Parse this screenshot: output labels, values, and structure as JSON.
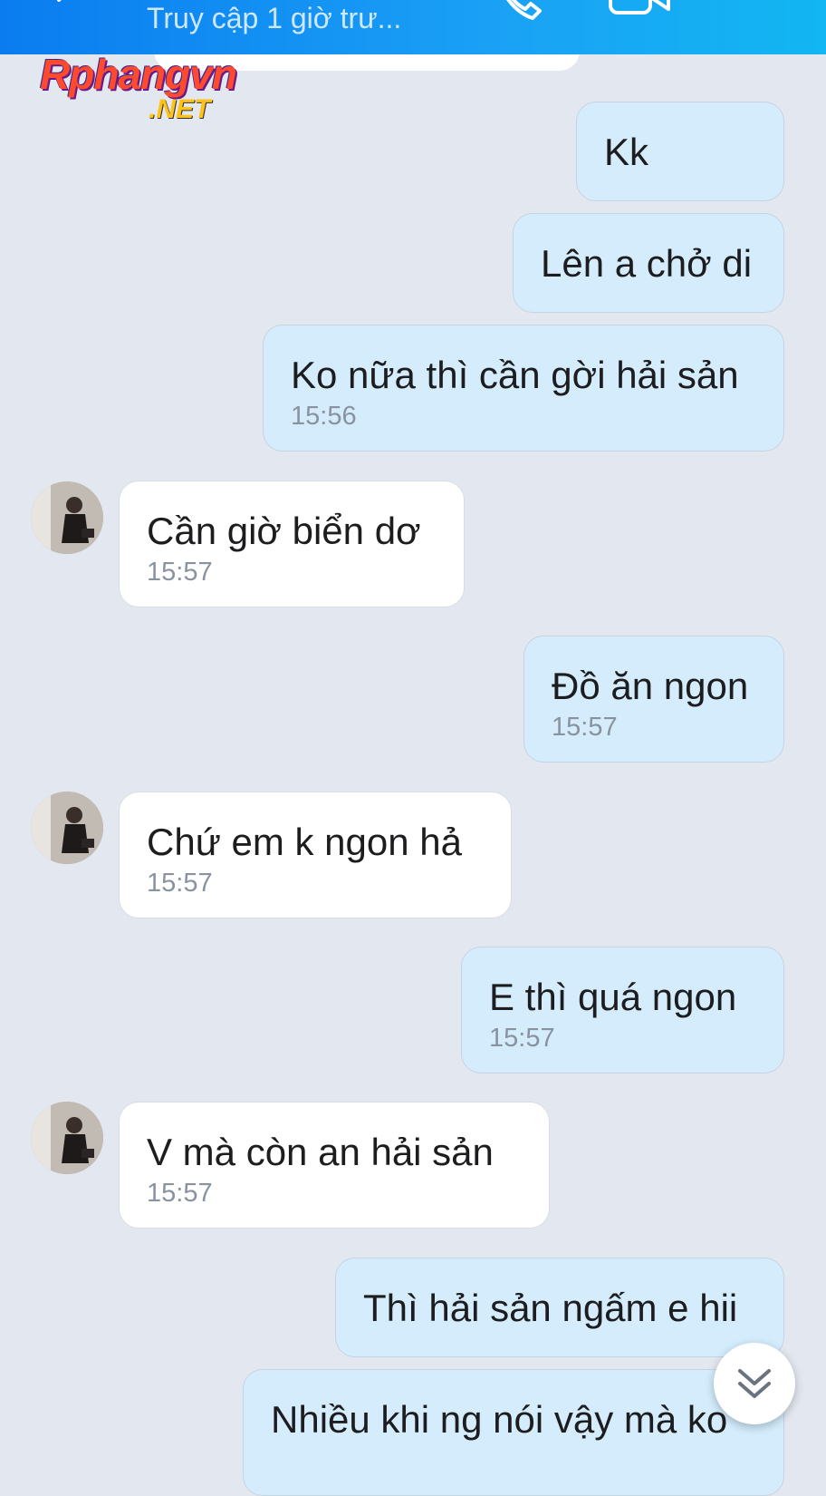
{
  "header": {
    "status": "Truy cập 1 giờ trư..."
  },
  "watermark": {
    "main": "Rphangvn",
    "sub": ".NET"
  },
  "messages": [
    {
      "text": "Kk"
    },
    {
      "text": "Lên a chở di"
    },
    {
      "text": "Ko nữa thì cần gời hải sản",
      "time": "15:56"
    },
    {
      "text": "Cần giờ biển dơ",
      "time": "15:57"
    },
    {
      "text": "Đồ ăn ngon",
      "time": "15:57"
    },
    {
      "text": "Chứ em k ngon hả",
      "time": "15:57"
    },
    {
      "text": "E thì quá ngon",
      "time": "15:57"
    },
    {
      "text": "V mà còn an hải sản",
      "time": "15:57"
    },
    {
      "text": "Thì hải sản ngấm e hii"
    },
    {
      "text": "Nhiều khi ng nói vậy mà ko"
    }
  ],
  "icons": {
    "back": "back-arrow-icon",
    "call": "phone-call-icon",
    "video": "video-call-icon",
    "menu": "menu-icon",
    "scroll": "double-chevron-down-icon"
  },
  "colors": {
    "header_start": "#0a7cf0",
    "header_end": "#12b6f2",
    "outgoing_bubble": "#d4ecfc",
    "incoming_bubble": "#ffffff",
    "background": "#e3e8f0"
  }
}
